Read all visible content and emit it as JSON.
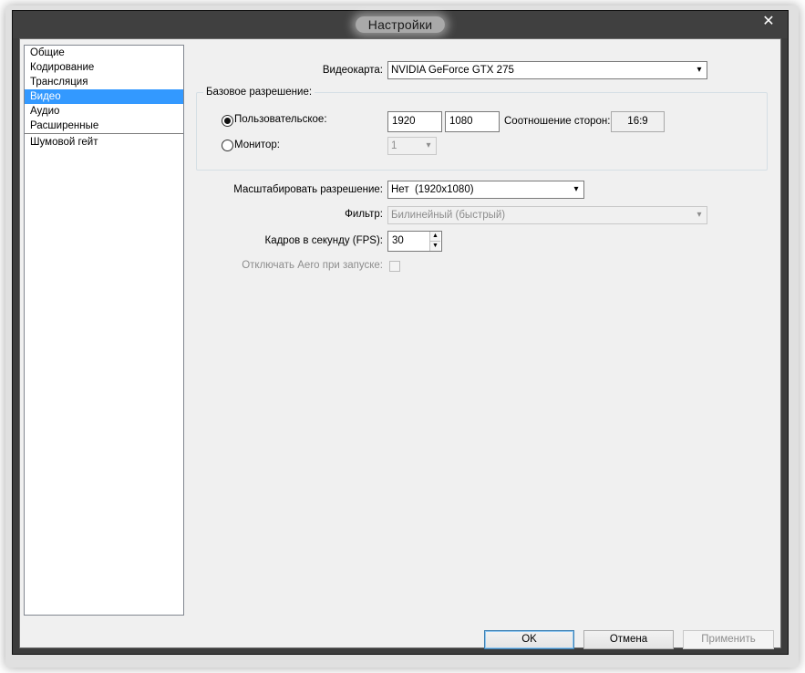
{
  "window": {
    "title": "Настройки",
    "close_glyph": "✕"
  },
  "sidebar": {
    "items": [
      {
        "label": "Общие"
      },
      {
        "label": "Кодирование"
      },
      {
        "label": "Трансляция"
      },
      {
        "label": "Видео",
        "selected": true
      },
      {
        "label": "Аудио"
      },
      {
        "label": "Расширенные"
      },
      {
        "label": "Шумовой гейт"
      }
    ]
  },
  "video": {
    "adapter_label": "Видеокарта:",
    "adapter_value": "NVIDIA GeForce GTX 275",
    "base_res_title": "Базовое разрешение:",
    "custom_label": "Пользовательское:",
    "custom_selected": true,
    "width_value": "1920",
    "height_value": "1080",
    "aspect_label": "Соотношение сторон:",
    "aspect_value": "16:9",
    "monitor_label": "Монитор:",
    "monitor_value": "1",
    "downscale_label": "Масштабировать разрешение:",
    "downscale_value": "Нет  (1920x1080)",
    "filter_label": "Фильтр:",
    "filter_value": "Билинейный (быстрый)",
    "fps_label": "Кадров в секунду (FPS):",
    "fps_value": "30",
    "aero_label": "Отключать Aero при запуске:",
    "aero_checked": false
  },
  "buttons": {
    "ok": "OK",
    "cancel": "Отмена",
    "apply": "Применить"
  },
  "icons": {
    "dropdown": "▾",
    "spin_up": "▲",
    "spin_down": "▼"
  }
}
